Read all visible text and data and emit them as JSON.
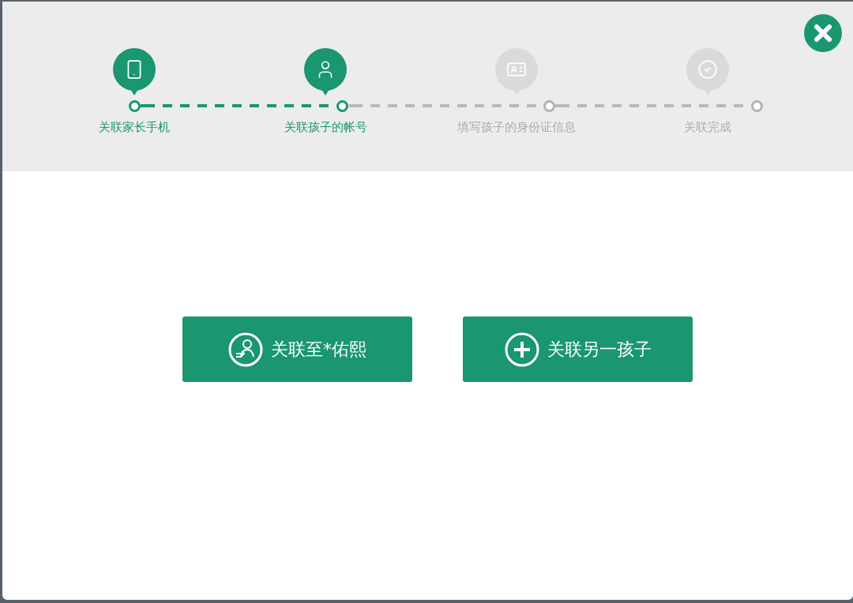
{
  "steps": [
    {
      "label": "关联家长手机",
      "active": true,
      "kind": "phone"
    },
    {
      "label": "关联孩子的帐号",
      "active": true,
      "kind": "user"
    },
    {
      "label": "填写孩子的身份证信息",
      "active": false,
      "kind": "card"
    },
    {
      "label": "关联完成",
      "active": false,
      "kind": "check"
    }
  ],
  "buttons": [
    {
      "label": "关联至*佑熙",
      "kind": "link-user"
    },
    {
      "label": "关联另一孩子",
      "kind": "add"
    }
  ]
}
